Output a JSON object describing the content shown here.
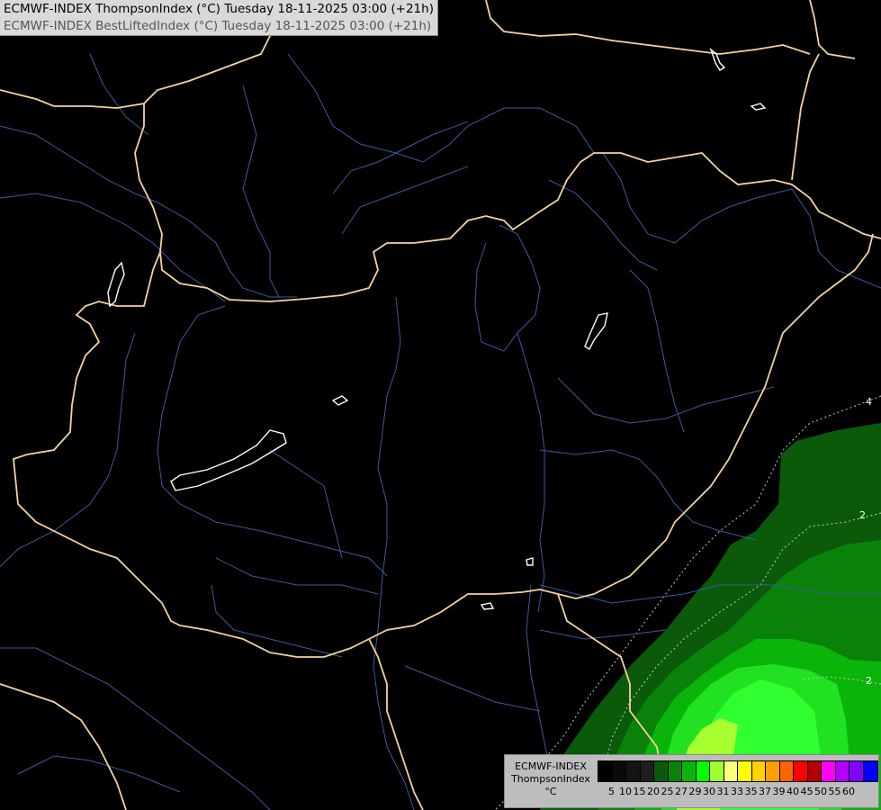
{
  "header": {
    "line1": "ECMWF-INDEX ThompsonIndex (°C) Tuesday 18-11-2025 03:00 (+21h)",
    "line2": "ECMWF-INDEX BestLiftedIndex (°C) Tuesday 18-11-2025 03:00 (+21h)"
  },
  "legend": {
    "title_line1": "ECMWF-INDEX",
    "title_line2": "ThompsonIndex",
    "title_line3": "°C",
    "ticks": [
      "5",
      "10",
      "15",
      "20",
      "25",
      "27",
      "29",
      "30",
      "31",
      "33",
      "35",
      "37",
      "39",
      "40",
      "45",
      "50",
      "55",
      "60"
    ],
    "colors": [
      "#000000",
      "#0a0a0a",
      "#141414",
      "#1e1e1e",
      "#0a5a0a",
      "#0a820a",
      "#0ab40a",
      "#00ff00",
      "#a0ff30",
      "#ffff80",
      "#ffff00",
      "#ffd200",
      "#ffa000",
      "#ff6400",
      "#ff0000",
      "#b40000",
      "#ff00ff",
      "#b400ff",
      "#8000ff",
      "#0000ff"
    ]
  },
  "contour_labels": [
    "4",
    "2",
    "2"
  ],
  "map_colors": {
    "background": "#000000",
    "borders": "#f5d2a0",
    "rivers": "#3c5aa0",
    "lakes": "#ffffff",
    "contour_lines": "#c8c8c8"
  }
}
